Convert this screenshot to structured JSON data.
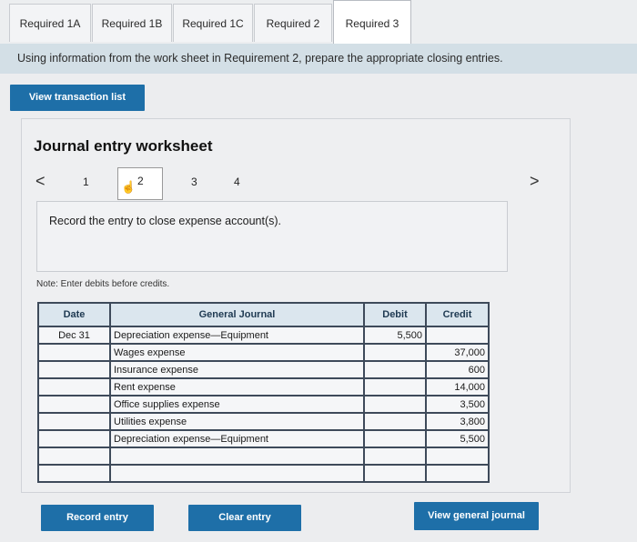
{
  "tabs": [
    {
      "label": "Required 1A"
    },
    {
      "label": "Required 1B"
    },
    {
      "label": "Required 1C"
    },
    {
      "label": "Required 2"
    },
    {
      "label": "Required 3"
    }
  ],
  "instruction": "Using information from the work sheet in Requirement 2, prepare the appropriate closing entries.",
  "view_transactions_label": "View transaction list",
  "worksheet": {
    "title": "Journal entry worksheet",
    "pages": [
      "1",
      "2",
      "3",
      "4"
    ],
    "current_page": "2",
    "prev_arrow": "<",
    "next_arrow": ">",
    "prompt": "Record the entry to close expense account(s).",
    "note": "Note: Enter debits before credits."
  },
  "journal": {
    "headers": {
      "date": "Date",
      "account": "General Journal",
      "debit": "Debit",
      "credit": "Credit"
    },
    "rows": [
      {
        "date": "Dec 31",
        "account": "Depreciation expense—Equipment",
        "debit": "5,500",
        "credit": ""
      },
      {
        "date": "",
        "account": "Wages expense",
        "debit": "",
        "credit": "37,000"
      },
      {
        "date": "",
        "account": "Insurance expense",
        "debit": "",
        "credit": "600"
      },
      {
        "date": "",
        "account": "Rent expense",
        "debit": "",
        "credit": "14,000"
      },
      {
        "date": "",
        "account": "Office supplies expense",
        "debit": "",
        "credit": "3,500"
      },
      {
        "date": "",
        "account": "Utilities expense",
        "debit": "",
        "credit": "3,800"
      },
      {
        "date": "",
        "account": "Depreciation expense—Equipment",
        "debit": "",
        "credit": "5,500"
      },
      {
        "date": "",
        "account": "",
        "debit": "",
        "credit": ""
      },
      {
        "date": "",
        "account": "",
        "debit": "",
        "credit": ""
      }
    ]
  },
  "buttons": {
    "record": "Record entry",
    "clear": "Clear entry",
    "view_journal": "View general journal"
  }
}
